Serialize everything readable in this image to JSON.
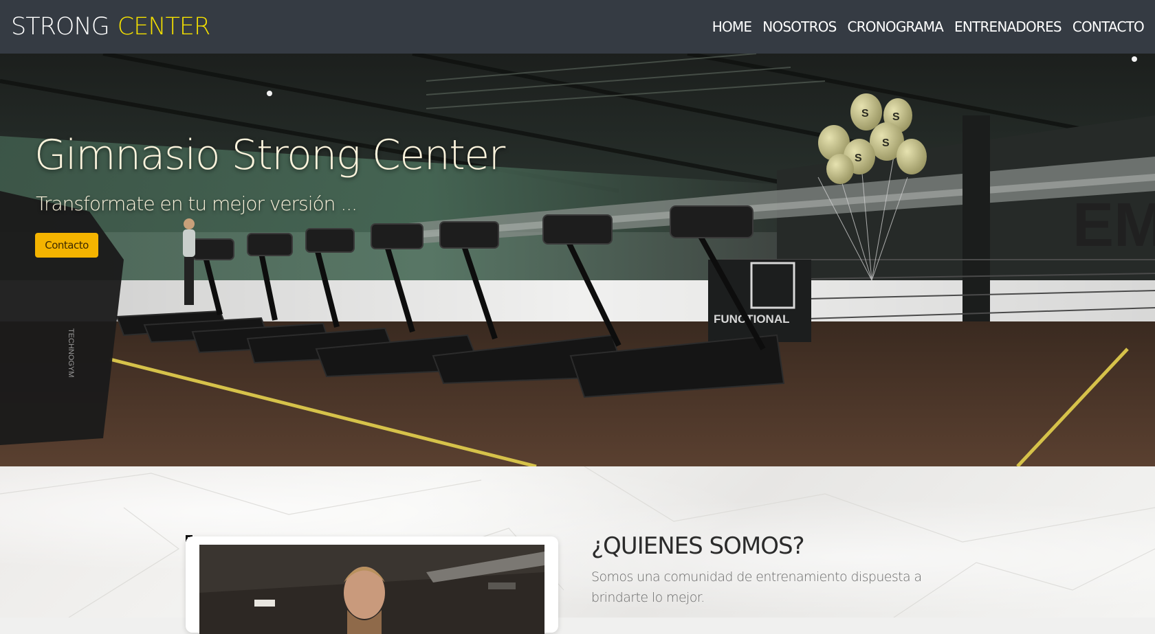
{
  "brand": {
    "part1": "STRONG",
    "part2": "CENTER",
    "accent_color": "#f4e000"
  },
  "nav": {
    "items": [
      {
        "label": "HOME"
      },
      {
        "label": "NOSOTROS"
      },
      {
        "label": "CRONOGRAMA"
      },
      {
        "label": "ENTRENADORES"
      },
      {
        "label": "CONTACTO"
      }
    ]
  },
  "hero": {
    "title": "Gimnasio Strong Center",
    "subtitle": "Transformate en tu mejor versión ...",
    "button_label": "Contacto",
    "button_color": "#f4b400",
    "balloon_letter": "S",
    "wall_letters": "EM",
    "zone_sign": "FUNCTIONAL",
    "machine_brand": "TECHNOGYM"
  },
  "about": {
    "title": "¿QUIENES SOMOS?",
    "text": "Somos una comunidad de entrenamiento dispuesta a brindarte lo mejor."
  },
  "colors": {
    "navbar_bg": "#353b43",
    "nav_text": "#ffffff",
    "hero_text": "#fbf3dc"
  }
}
